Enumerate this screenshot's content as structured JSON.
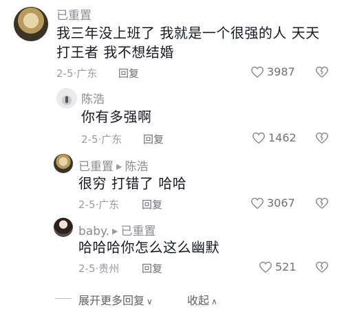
{
  "comments": [
    {
      "username": "已重置",
      "text": "我三年没上班了 我就是一个很强的人 天天打王者 我不想结婚",
      "date": "2-5",
      "location": "广东",
      "reply_label": "回复",
      "likes": "3987"
    },
    {
      "username": "陈浩",
      "text": "你有多强啊",
      "date": "2-5",
      "location": "广东",
      "reply_label": "回复",
      "likes": "1462"
    },
    {
      "username": "已重置",
      "reply_to": "陈浩",
      "text": "很穷 打错了 哈哈",
      "date": "2-5",
      "location": "广东",
      "reply_label": "回复",
      "likes": "3067"
    },
    {
      "username": "baby.",
      "reply_to": "已重置",
      "text": "哈哈哈你怎么这么幽默",
      "date": "2-5",
      "location": "贵州",
      "reply_label": "回复",
      "likes": "521"
    }
  ],
  "footer": {
    "expand_label": "展开更多回复",
    "collapse_label": "收起"
  },
  "icons": {
    "like": "heart-outline-icon",
    "dislike": "broken-heart-icon",
    "reply_arrow": "triangle-right-icon",
    "expand_chevron": "chevron-down-icon",
    "collapse_chevron": "chevron-up-icon"
  }
}
